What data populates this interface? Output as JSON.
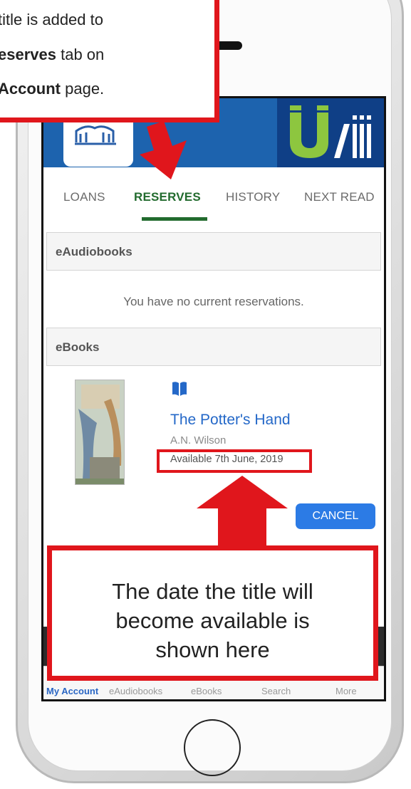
{
  "annotations": {
    "top_line1": "title is added to",
    "top_line2_bold": "eserves",
    "top_line2_rest": " tab on",
    "top_line3_bold": "Account",
    "top_line3_rest": " page.",
    "bottom_line1": "The date the title will",
    "bottom_line2": "become available is",
    "bottom_line3": "shown here",
    "accent_color": "#e0161c"
  },
  "tabs": {
    "loans": "LOANS",
    "reserves": "RESERVES",
    "history": "HISTORY",
    "next_read": "NEXT READ",
    "active": "RESERVES"
  },
  "sections": {
    "eaudiobooks": {
      "title": "eAudiobooks",
      "empty_message": "You have no current reservations."
    },
    "ebooks": {
      "title": "eBooks",
      "items": [
        {
          "icon": "open-book-icon",
          "title": "The Potter's Hand",
          "author": "A.N. Wilson",
          "availability": "Available 7th June, 2019",
          "cancel_label": "CANCEL"
        }
      ]
    }
  },
  "bottom_nav": [
    "My Account",
    "eAudiobooks",
    "eBooks",
    "Search",
    "More"
  ],
  "colors": {
    "header_blue": "#1d63ae",
    "active_tab_green": "#226b2e",
    "link_blue": "#2468c8",
    "button_blue": "#2c7be5"
  }
}
